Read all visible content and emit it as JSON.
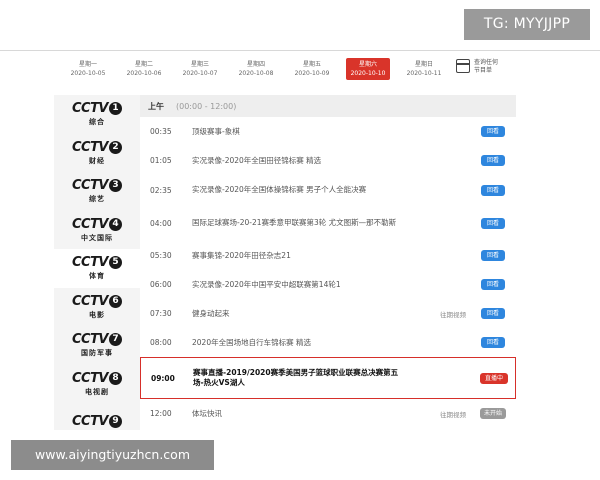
{
  "watermark_top": "TG: MYYJJPP",
  "watermark_bottom": "www.aiyingtiyuzhcn.com",
  "dates": [
    {
      "weekday": "星期一",
      "date": "2020-10-05"
    },
    {
      "weekday": "星期二",
      "date": "2020-10-06"
    },
    {
      "weekday": "星期三",
      "date": "2020-10-07"
    },
    {
      "weekday": "星期四",
      "date": "2020-10-08"
    },
    {
      "weekday": "星期五",
      "date": "2020-10-09"
    },
    {
      "weekday": "星期六",
      "date": "2020-10-10"
    },
    {
      "weekday": "星期日",
      "date": "2020-10-11"
    }
  ],
  "calendar": {
    "label_1": "查询任何",
    "label_2": "节目单"
  },
  "channels": [
    {
      "text": "CCTV",
      "num": "1",
      "sub": "综合"
    },
    {
      "text": "CCTV",
      "num": "2",
      "sub": "财经"
    },
    {
      "text": "CCTV",
      "num": "3",
      "sub": "综艺"
    },
    {
      "text": "CCTV",
      "num": "4",
      "sub": "中文国际"
    },
    {
      "text": "CCTV",
      "num": "5",
      "sub": "体育"
    },
    {
      "text": "CCTV",
      "num": "6",
      "sub": "电影"
    },
    {
      "text": "CCTV",
      "num": "7",
      "sub": "国防军事"
    },
    {
      "text": "CCTV",
      "num": "8",
      "sub": "电视剧"
    },
    {
      "text": "CCTV",
      "num": "9",
      "sub": ""
    }
  ],
  "period": {
    "label": "上午",
    "range": "(00:00 - 12:00)"
  },
  "programs": [
    {
      "time": "00:35",
      "title": "顶级赛事-象棋",
      "review": "",
      "btn": "回看"
    },
    {
      "time": "01:05",
      "title": "实况录像-2020年全国田径锦标赛 精选",
      "review": "",
      "btn": "回看"
    },
    {
      "time": "02:35",
      "title": "实况录像-2020年全国体操锦标赛 男子个人全能决赛",
      "review": "",
      "btn": "回看"
    },
    {
      "time": "04:00",
      "title": "国际足球赛场-20-21赛季意甲联赛第3轮 尤文图斯—那不勒斯",
      "review": "",
      "btn": "回看"
    },
    {
      "time": "05:30",
      "title": "赛事集锦-2020年田径杂志21",
      "review": "",
      "btn": "回看"
    },
    {
      "time": "06:00",
      "title": "实况录像-2020年中国平安中超联赛第14轮1",
      "review": "",
      "btn": "回看"
    },
    {
      "time": "07:30",
      "title": "健身动起来",
      "review": "往期视频",
      "btn": "回看"
    },
    {
      "time": "08:00",
      "title": "2020年全国场地自行车锦标赛 精选",
      "review": "",
      "btn": "回看"
    },
    {
      "time": "09:00",
      "title": "赛事直播-2019/2020赛季美国男子篮球职业联赛总决赛第五场-热火VS湖人",
      "review": "",
      "btn": "直播中"
    },
    {
      "time": "12:00",
      "title": "体坛快讯",
      "review": "往期视频",
      "btn": "未开始"
    }
  ],
  "colors": {
    "accent_red": "#d9342a",
    "replay_blue": "#2e86de",
    "pending_gray": "#9a9a9a"
  }
}
